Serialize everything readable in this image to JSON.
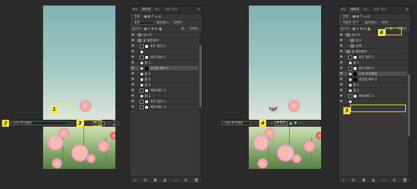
{
  "left_window": {
    "prompt_input": {
      "value": "나비 추가해줘"
    },
    "generate_button": {
      "label": "생성"
    },
    "more_label": "···",
    "trailing_label": "취소",
    "badges": [
      "1",
      "2",
      "3"
    ]
  },
  "right_window": {
    "prompt_input": {
      "value": "나비 추가해줘"
    },
    "pager": {
      "prev": "‹",
      "index": "4",
      "next": "›"
    },
    "generate_button": {
      "label": "생성"
    },
    "badges": [
      "4",
      "5",
      "6"
    ]
  },
  "layers_panel_left": {
    "tabs": [
      "채널",
      "레이어",
      "패스",
      "작업 내역"
    ],
    "active_tab": "레이어",
    "kind_filter": "종류",
    "blend_mode": "표준",
    "opacity_label": "불투명도:",
    "opacity_value": "100%",
    "lock_label": "잠그기:",
    "fill_label": "칠:",
    "fill_value": "100%",
    "layers": [
      {
        "name": "텍스트",
        "type": "folder",
        "indent": 0
      },
      {
        "name": "꽃 배경화면",
        "type": "folder",
        "indent": 0
      },
      {
        "name": "포토 필터 2",
        "type": "adjustment",
        "indent": 1
      },
      {
        "name": "",
        "type": "pixel",
        "indent": 1
      },
      {
        "name": "명도/대비 1",
        "type": "adjustment",
        "indent": 1
      },
      {
        "name": "꽃 1",
        "type": "pixel",
        "indent": 1
      },
      {
        "name": "생성형 채우기",
        "type": "generative",
        "indent": 1,
        "selected": true
      },
      {
        "name": "꽃 3",
        "type": "pixel",
        "indent": 1
      },
      {
        "name": "꽃 2",
        "type": "pixel",
        "indent": 1
      },
      {
        "name": "꽃 2",
        "type": "pixel",
        "indent": 1
      },
      {
        "name": "색조/채도 2",
        "type": "adjustment",
        "indent": 1
      },
      {
        "name": "꽃 2",
        "type": "pixel",
        "indent": 1
      },
      {
        "name": "포토 필터 1",
        "type": "adjustment",
        "indent": 1
      },
      {
        "name": "색조/채도 2",
        "type": "adjustment",
        "indent": 1
      }
    ]
  },
  "layers_panel_right": {
    "tabs": [
      "채널",
      "레이어",
      "패스",
      "작업 내역"
    ],
    "active_tab": "레이어",
    "kind_filter": "종류",
    "blend_mode": "어둡게 하기",
    "opacity_label": "불투명도:",
    "opacity_value": "66%",
    "lock_label": "잠그기:",
    "fill_label": "칠:",
    "fill_value": "100%",
    "layers": [
      {
        "name": "텍스트",
        "type": "folder",
        "indent": 0
      },
      {
        "name": "문구",
        "type": "folder",
        "indent": 1
      },
      {
        "name": "날짜",
        "type": "folder",
        "indent": 1
      },
      {
        "name": "꽃 배경화면",
        "type": "folder",
        "indent": 0
      },
      {
        "name": "포토 필터 2",
        "type": "adjustment",
        "indent": 1
      },
      {
        "name": "꽃 1",
        "type": "pixel",
        "indent": 1
      },
      {
        "name": "명도/대비 1",
        "type": "adjustment",
        "indent": 1
      },
      {
        "name": "나비 추가해줘",
        "type": "generative",
        "indent": 1,
        "selected": true
      },
      {
        "name": "생성형 채우기",
        "type": "generative",
        "indent": 1
      },
      {
        "name": "꽃 3",
        "type": "pixel",
        "indent": 1
      },
      {
        "name": "꽃 2",
        "type": "pixel",
        "indent": 1
      },
      {
        "name": "색조/채도 1",
        "type": "adjustment",
        "indent": 1
      },
      {
        "name": "",
        "type": "pixel",
        "indent": 1
      }
    ]
  },
  "colors": {
    "badge": "#f5e642",
    "panel": "#383838",
    "background": "#2b2b2b",
    "selected_layer": "#4f4f4f"
  }
}
